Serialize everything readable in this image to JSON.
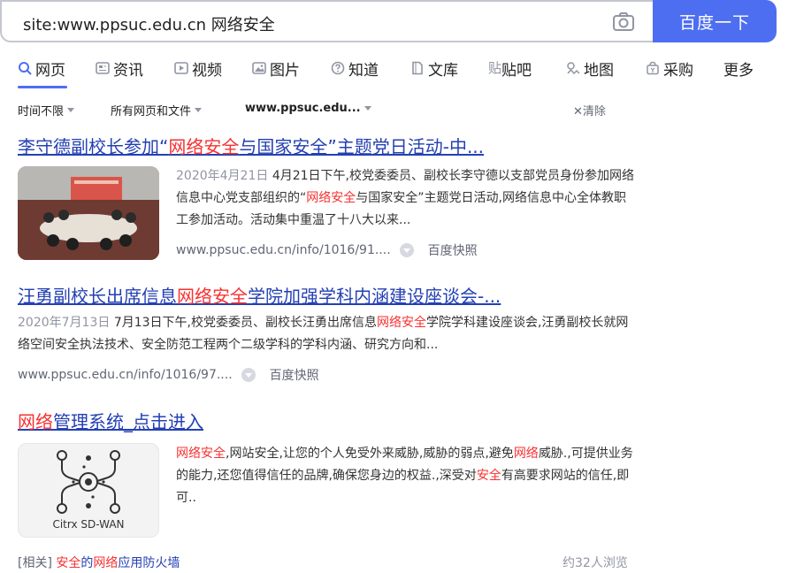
{
  "search": {
    "query": "site:www.ppsuc.edu.cn 网络安全",
    "button_label": "百度一下"
  },
  "tabs": [
    {
      "label": "网页",
      "icon": "search-icon"
    },
    {
      "label": "资讯",
      "icon": "news-icon"
    },
    {
      "label": "视频",
      "icon": "video-icon"
    },
    {
      "label": "图片",
      "icon": "image-icon"
    },
    {
      "label": "知道",
      "icon": "question-icon"
    },
    {
      "label": "文库",
      "icon": "doc-icon"
    },
    {
      "label": "贴吧",
      "icon": "tieba-icon"
    },
    {
      "label": "地图",
      "icon": "map-icon"
    },
    {
      "label": "采购",
      "icon": "shop-icon"
    },
    {
      "label": "更多",
      "icon": ""
    }
  ],
  "filters": {
    "time": "时间不限",
    "type": "所有网页和文件",
    "site": "www.ppsuc.edu...",
    "clear": "清除"
  },
  "results": [
    {
      "title_pre": "李守德副校长参加“",
      "title_hl": "网络安全",
      "title_post": "与国家安全”主题党日活动-中...",
      "date": "2020年4月21日",
      "abstract_a": "4月21日下午,校党委委员、副校长李守德以支部党员身份参加网络信息中心党支部组织的“",
      "abstract_hl": "网络安全",
      "abstract_b": "与国家安全”主题党日活动,网络信息中心全体教职工参加活动。活动集中重温了十八大以来...",
      "url": "www.ppsuc.edu.cn/info/1016/91....",
      "snapshot": "百度快照"
    },
    {
      "title_pre": "汪勇副校长出席信息",
      "title_hl": "网络安全",
      "title_post": "学院加强学科内涵建设座谈会-...",
      "date": "2020年7月13日",
      "abstract_a": "7月13日下午,校党委委员、副校长汪勇出席信息",
      "abstract_hl": "网络安全",
      "abstract_b": "学院学科建设座谈会,汪勇副校长就网络空间安全执法技术、安全防范工程两个二级学科的学科内涵、研究方向和...",
      "url": "www.ppsuc.edu.cn/info/1016/97....",
      "snapshot": "百度快照"
    },
    {
      "title_hl": "网络",
      "title_post": "管理系统_点击进入",
      "abstract_hl1": "网络安全",
      "abstract_a": ",网站安全,让您的个人免受外来威胁,威胁的弱点,避免",
      "abstract_hl2": "网络",
      "abstract_b": "威胁.,可提供业务的能力,还您值得信任的品牌,确保您身边的权益.,深受对",
      "abstract_hl3": "安全",
      "abstract_c": "有高要求网站的信任,即可..",
      "thumb_caption": "Citrx SD-WAN"
    }
  ],
  "related": {
    "label": "[相关]",
    "link_a": "安全",
    "link_b": "的",
    "link_c": "网络",
    "link_d": "应用防火墙"
  },
  "views": "约32人浏览",
  "colors": {
    "accent": "#4e6ef2",
    "link": "#2440b3",
    "highlight": "#f73131"
  }
}
